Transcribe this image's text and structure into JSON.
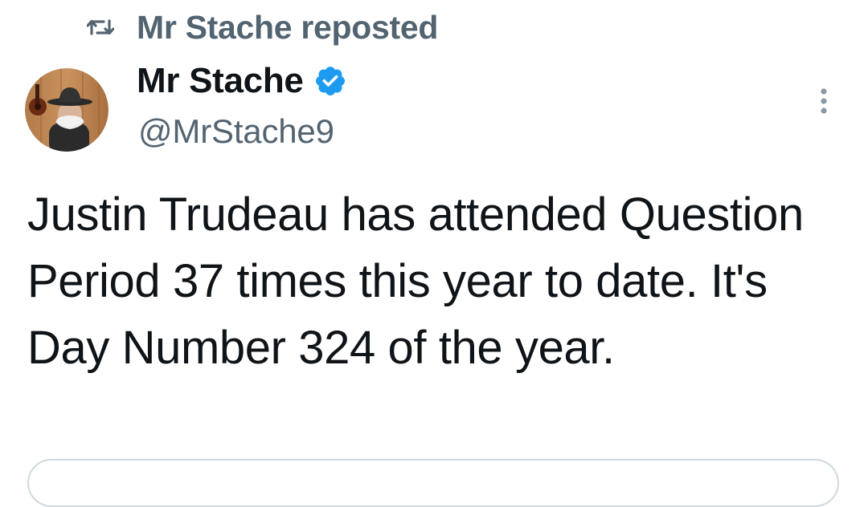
{
  "repost": {
    "icon": "repost-icon",
    "text": "Mr Stache reposted"
  },
  "author": {
    "avatar_icon": "avatar",
    "display_name": "Mr Stache",
    "verified_icon": "verified-badge-icon",
    "handle": "@MrStache9"
  },
  "post": {
    "text": "Justin Trudeau has attended Question Period 37 times this year to date. It's Day Number 324 of the year."
  },
  "menu": {
    "icon": "more-vertical-icon"
  },
  "colors": {
    "primary_text": "#0f1419",
    "secondary_text": "#536471",
    "verified_blue": "#1d9bf0",
    "border": "#cfd9de"
  }
}
